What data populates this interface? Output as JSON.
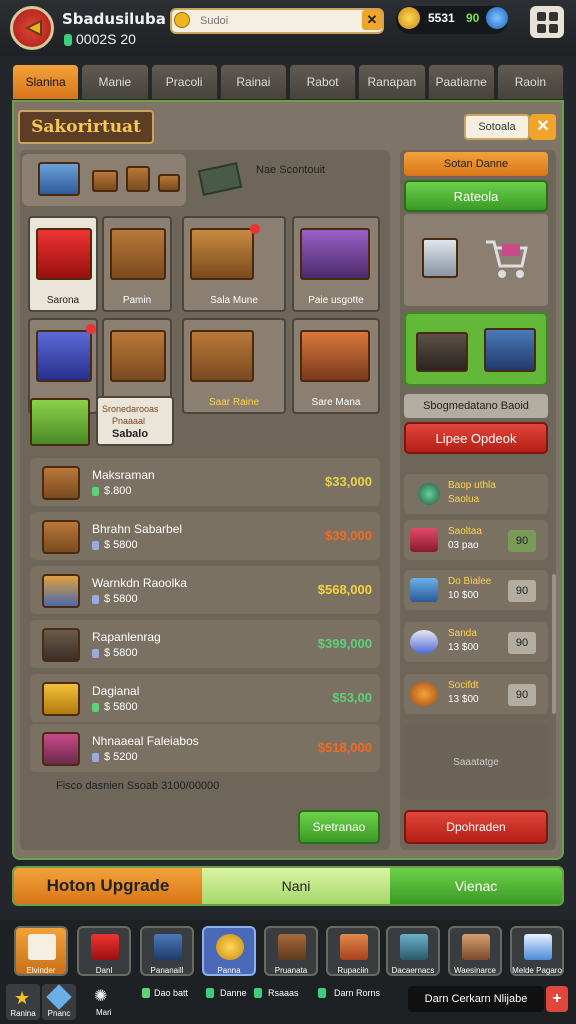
{
  "header": {
    "title": "Sbadusiluba",
    "subtitle": "0002S 20",
    "search_placeholder": "Sudoi",
    "currency_a": "5531",
    "currency_b": "90"
  },
  "tabs": [
    "Slanina",
    "Manie",
    "Pracoli",
    "Rainai",
    "Rabot",
    "Ranapan",
    "Paatiarne",
    "Raoin"
  ],
  "section": {
    "title": "Sakorirtuat",
    "filter_label": "Sotoala",
    "category_label": "Nae Scontouit"
  },
  "tiles": [
    {
      "label": "Sarona"
    },
    {
      "label": "Pamin"
    },
    {
      "label": "Sala Mune"
    },
    {
      "label": "Paie usgotte"
    },
    {
      "label": ""
    },
    {
      "label": ""
    },
    {
      "label": "Saar Raine"
    },
    {
      "label": "Sare Mana"
    }
  ],
  "promo_tile": {
    "line1": "Sronedarooas",
    "line2": "Pnaaaal",
    "line3": "Sabalo"
  },
  "items": [
    {
      "name": "Maksraman",
      "price": "$.800",
      "cost": "$33,000",
      "cost_color": "#e7d34a"
    },
    {
      "name": "Bhrahn Sabarbel",
      "price": "$ 5800",
      "cost": "$39,000",
      "cost_color": "#f26b21"
    },
    {
      "name": "Warnkdn Raoolka",
      "price": "$ 5800",
      "cost": "$568,000",
      "cost_color": "#f7d33a"
    },
    {
      "name": "Rapanlenrag",
      "price": "$ 5800",
      "cost": "$399,000",
      "cost_color": "#5ad17a"
    },
    {
      "name": "Dagianal",
      "price": "$ 5800",
      "cost": "$53,00",
      "cost_color": "#5ad17a"
    },
    {
      "name": "Nhnaaeal Faleiabos",
      "price": "$ 5200",
      "cost": "$518,000",
      "cost_color": "#f26b21"
    }
  ],
  "footnote": "Fisco dasnien  Ssoab 3100/00000",
  "left_button": "Sretranao",
  "right": {
    "header": "Sotan Danne",
    "green_button": "Rateola",
    "grey_label": "Sbogmedatano Baoid",
    "red_button": "Lipee Opdeok",
    "items": [
      {
        "name": "Baop uthla",
        "price": "Saolua",
        "box": ""
      },
      {
        "name": "Saoltaa",
        "price": "03 pao",
        "box": "90"
      },
      {
        "name": "Do Bialee",
        "price": "10 $00",
        "box": "90"
      },
      {
        "name": "Sanda",
        "price": "13 $00",
        "box": "90"
      },
      {
        "name": "Socifdt",
        "price": "13 $00",
        "box": "90"
      }
    ],
    "empty_label": "Saaatatge",
    "bottom_button": "Dpohraden"
  },
  "upgrade": {
    "left": "Hoton Upgrade",
    "mid": "Nani",
    "right": "Vienac"
  },
  "dock": [
    "Elvinder",
    "Danl",
    "Pananaill",
    "Panna",
    "Pruanata",
    "Rupaciin",
    "Dacaernacs",
    "Waesinarce",
    "Melde Pagaro"
  ],
  "bottom": {
    "mini1": "Ranina",
    "mini2": "Pnanc",
    "mini3": "Mari",
    "b1": "Dao batt",
    "b2": "Danne",
    "b3": "Rsaaas",
    "b4": "Darn Rorns",
    "cta": "Darn Cerkarn Nlijabe",
    "plus": "+"
  },
  "colors": {
    "accent_orange": "#e88a25",
    "green": "#4fb832",
    "red": "#d6342a",
    "frame": "#6aa048"
  }
}
